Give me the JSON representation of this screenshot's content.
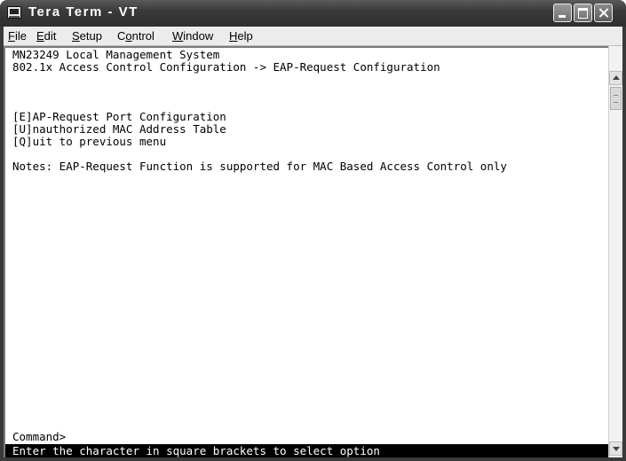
{
  "window": {
    "title": "Tera Term - VT",
    "icon": "terminal-app-icon"
  },
  "menubar": {
    "items": [
      {
        "accel": "F",
        "rest": "ile"
      },
      {
        "accel": "E",
        "rest": "dit"
      },
      {
        "accel": "S",
        "rest": "etup"
      },
      {
        "pre": "C",
        "accel": "o",
        "rest": "ntrol"
      },
      {
        "accel": "W",
        "rest": "indow"
      },
      {
        "accel": "H",
        "rest": "elp"
      }
    ]
  },
  "terminal": {
    "lines": [
      "MN23249 Local Management System",
      "802.1x Access Control Configuration -> EAP-Request Configuration",
      "[E]AP-Request Port Configuration",
      "[U]nauthorized MAC Address Table",
      "[Q]uit to previous menu",
      "Notes: EAP-Request Function is supported for MAC Based Access Control only",
      "Command>"
    ],
    "status_line": "Enter the character in square brackets to select option"
  },
  "colors": {
    "titlebar": "#2e2e2e",
    "terminal_bg": "#ffffff",
    "status_bg": "#000000"
  }
}
